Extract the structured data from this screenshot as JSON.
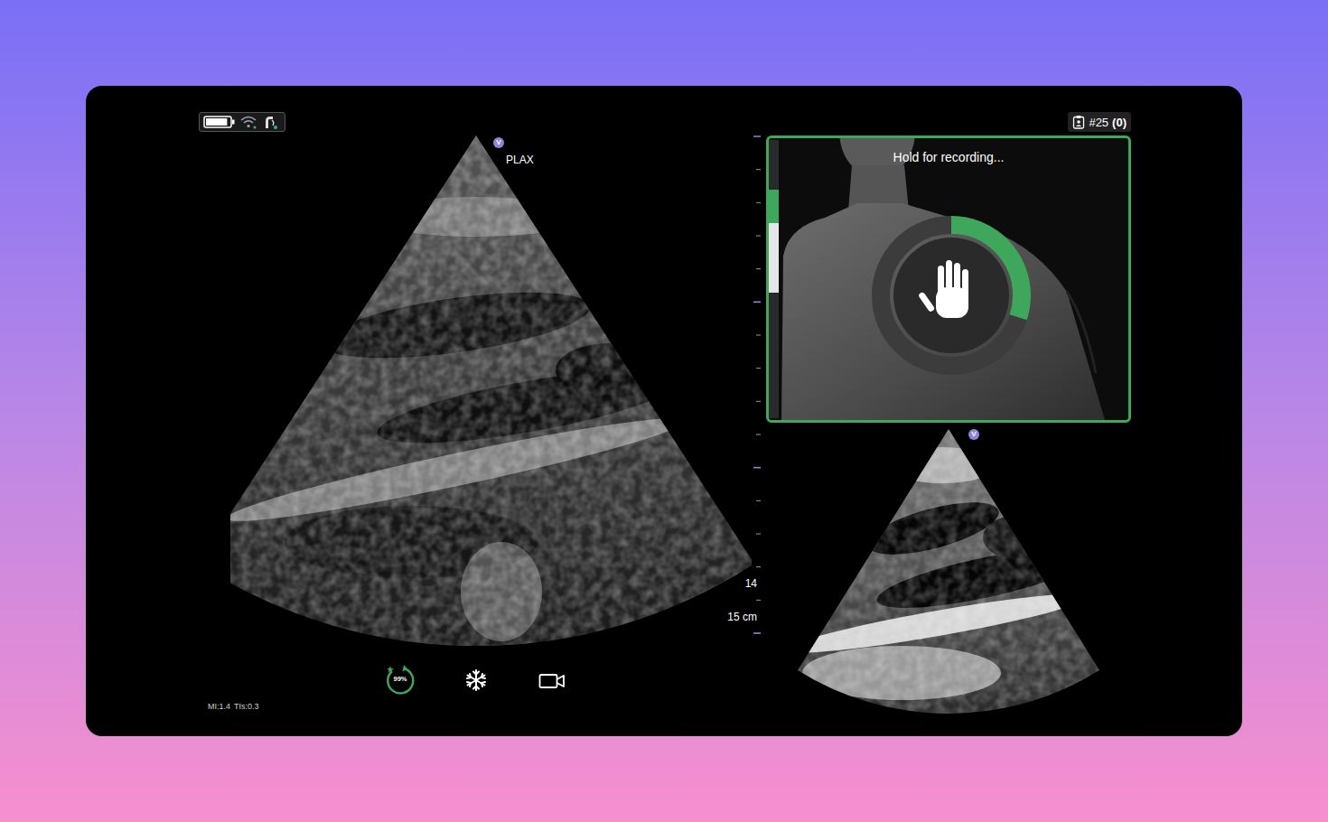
{
  "status": {
    "battery": {
      "level": 0.9
    }
  },
  "counter": {
    "number": "#25",
    "pending": "(0)"
  },
  "main_view": {
    "view_label": "PLAX",
    "orientation_marker": "V",
    "depth_labels": [
      "14",
      "15 cm"
    ]
  },
  "controls": {
    "auto_capture": {
      "label": "99%"
    }
  },
  "acoustic_output": {
    "mi": "MI:1.4",
    "tis": "TIs:0.3"
  },
  "guidance": {
    "message": "Hold for recording...",
    "progress": {
      "level": 0.3
    },
    "quality_bar": {
      "segments": [
        {
          "level": 0.18,
          "color": "#2a2a2a"
        },
        {
          "level": 0.12,
          "color": "#3fa75b"
        },
        {
          "level": 0.25,
          "color": "#e6e6e6"
        },
        {
          "level": 0.45,
          "color": "#2a2a2a"
        }
      ]
    }
  },
  "secondary_view": {
    "orientation_marker": "V"
  }
}
